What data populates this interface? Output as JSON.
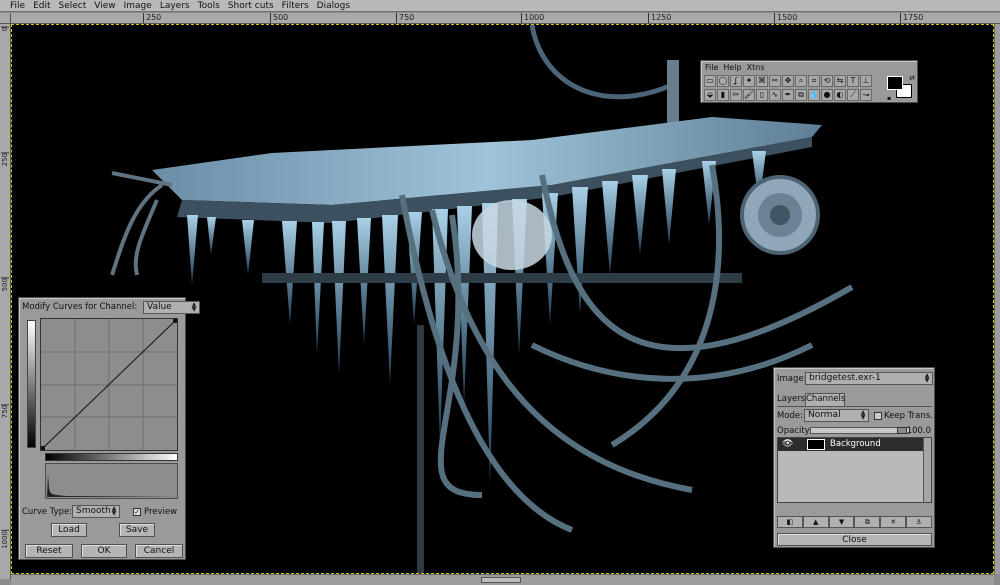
{
  "menubar": {
    "items": [
      "File",
      "Edit",
      "Select",
      "View",
      "Image",
      "Layers",
      "Tools",
      "Short cuts",
      "Filters",
      "Dialogs"
    ]
  },
  "ruler": {
    "horizontal_ticks": [
      "250",
      "500",
      "750",
      "1000",
      "1250",
      "1500",
      "1750"
    ],
    "vertical_ticks": [
      "0",
      "250",
      "500",
      "750",
      "1000"
    ]
  },
  "toolbox": {
    "menu": [
      "File",
      "Help",
      "Xtns"
    ],
    "row1_icons": [
      "rect-select-icon",
      "ellipse-select-icon",
      "lasso-icon",
      "fuzzy-select-icon",
      "bezier-select-icon",
      "scissors-icon",
      "move-icon",
      "zoom-icon",
      "crop-icon",
      "transform-icon",
      "flip-icon",
      "text-icon",
      "color-picker-icon"
    ],
    "row1_glyphs": [
      "▭",
      "◯",
      "ʆ",
      "✦",
      "⌘",
      "✂",
      "✥",
      "⌕",
      "⌗",
      "⟲",
      "⇆",
      "T",
      "⊥"
    ],
    "row2_icons": [
      "bucket-icon",
      "gradient-icon",
      "pencil-icon",
      "brush-icon",
      "eraser-icon",
      "airbrush-icon",
      "ink-icon",
      "clone-icon",
      "convolve-icon",
      "smudge-icon",
      "dodge-icon",
      "measure-icon",
      "path-icon"
    ],
    "row2_glyphs": [
      "⬙",
      "▮",
      "✏",
      "🖌",
      "▯",
      "∿",
      "✒",
      "⧉",
      "💧",
      "●",
      "◐",
      "⟋",
      "↝"
    ],
    "fg_color": "#000000",
    "bg_color": "#ffffff"
  },
  "curves": {
    "title": "Modify Curves for Channel:",
    "channel": "Value",
    "curve_type_label": "Curve Type:",
    "curve_type": "Smooth",
    "preview_label": "Preview",
    "preview_checked": true,
    "load_label": "Load",
    "save_label": "Save",
    "reset_label": "Reset",
    "ok_label": "OK",
    "cancel_label": "Cancel"
  },
  "layers": {
    "image_label": "Image:",
    "image_name": "bridgetest.exr-1",
    "tabs": [
      "Layers",
      "Channels"
    ],
    "mode_label": "Mode:",
    "mode": "Normal",
    "keep_trans_label": "Keep Trans.",
    "opacity_label": "Opacity:",
    "opacity_value": "100.0",
    "opacity_fraction": 1.0,
    "layer_name": "Background",
    "buttons": [
      "new-layer-icon",
      "raise-layer-icon",
      "lower-layer-icon",
      "duplicate-layer-icon",
      "delete-layer-icon",
      "anchor-layer-icon"
    ],
    "button_glyphs": [
      "◧",
      "▲",
      "▼",
      "⧉",
      "✕",
      "⚓"
    ],
    "close_label": "Close"
  }
}
